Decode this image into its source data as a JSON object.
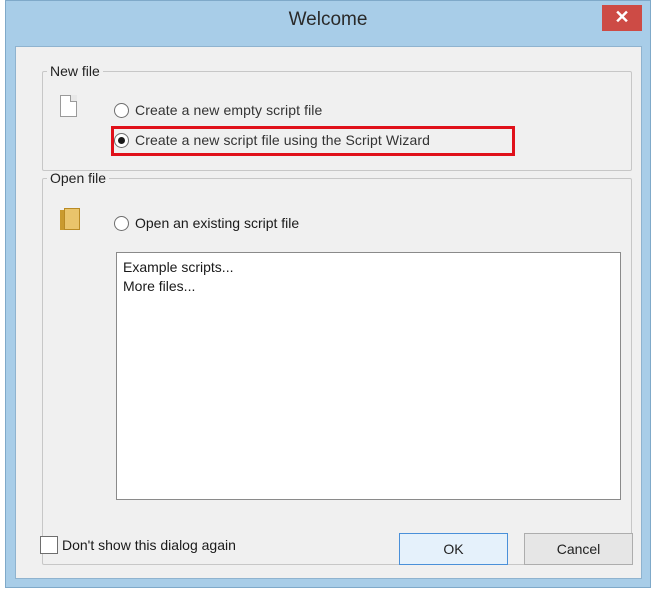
{
  "window": {
    "title": "Welcome",
    "close_glyph": "✕"
  },
  "new_file": {
    "legend": "New file",
    "icon": "document-icon",
    "options": [
      {
        "label": "Create a new empty script file",
        "checked": false
      },
      {
        "label": "Create a new script file using the Script Wizard",
        "checked": true
      }
    ]
  },
  "open_file": {
    "legend": "Open file",
    "icon": "folder-icon",
    "option_label": "Open an existing script file",
    "option_checked": false,
    "list_items": [
      "Example scripts...",
      "More files..."
    ]
  },
  "footer": {
    "checkbox_label": "Don't show this dialog again",
    "checkbox_checked": false,
    "ok_label": "OK",
    "cancel_label": "Cancel"
  },
  "colors": {
    "frame": "#a8cde8",
    "close_button": "#cd4b45",
    "highlight_border": "#e0101a",
    "ok_border": "#4a90d9"
  }
}
